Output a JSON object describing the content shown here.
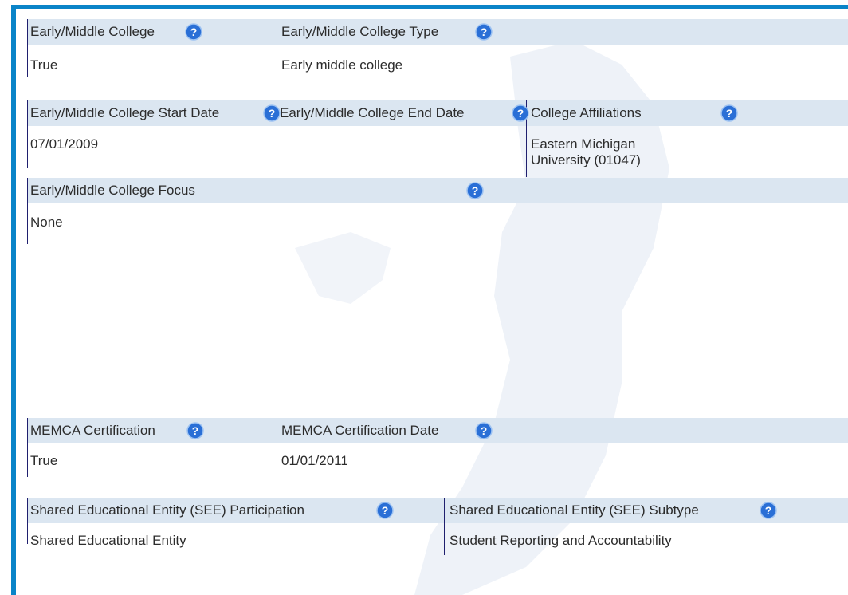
{
  "icons": {
    "help": "help-icon"
  },
  "colors": {
    "accent": "#0a84c8",
    "header_bar": "#dbe6f1",
    "divider": "#1f1f6e"
  },
  "rows": {
    "emc": {
      "col1": {
        "label": "Early/Middle College",
        "value": "True"
      },
      "col2": {
        "label": "Early/Middle College Type",
        "value": "Early middle college"
      }
    },
    "dates": {
      "col1": {
        "label": "Early/Middle College Start Date",
        "value": "07/01/2009"
      },
      "col2": {
        "label": "Early/Middle College End Date",
        "value": ""
      },
      "col3": {
        "label": "College Affiliations",
        "value_line1": "Eastern Michigan",
        "value_line2": "University (01047)"
      }
    },
    "focus": {
      "label": "Early/Middle College Focus",
      "value": "None"
    },
    "memca": {
      "col1": {
        "label": "MEMCA Certification",
        "value": "True"
      },
      "col2": {
        "label": "MEMCA Certification Date",
        "value": "01/01/2011"
      }
    },
    "see": {
      "col1": {
        "label": "Shared Educational Entity (SEE) Participation",
        "value": "Shared Educational Entity"
      },
      "col2": {
        "label": "Shared Educational Entity (SEE) Subtype",
        "value": "Student Reporting and Accountability"
      }
    }
  }
}
